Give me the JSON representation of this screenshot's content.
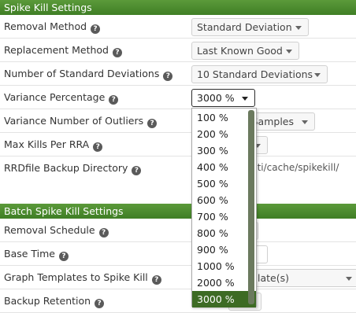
{
  "sections": {
    "spike_kill": {
      "title": "Spike Kill Settings"
    },
    "batch_spike_kill": {
      "title": "Batch Spike Kill Settings"
    }
  },
  "help_icon_glyph": "?",
  "fields": {
    "removal_method": {
      "label": "Removal Method",
      "value": "Standard Deviation"
    },
    "replacement_method": {
      "label": "Replacement Method",
      "value": "Last Known Good"
    },
    "num_std_devs": {
      "label": "Number of Standard Deviations",
      "value": "10 Standard Deviations"
    },
    "variance_percentage": {
      "label": "Variance Percentage",
      "value": "3000 %"
    },
    "variance_outliers": {
      "label": "Variance Number of Outliers",
      "value_fragment": "Samples"
    },
    "max_kills": {
      "label": "Max Kills Per RRA"
    },
    "backup_dir": {
      "label": "RRDfile Backup Directory",
      "value_fragment": "/cacti/cache/spikekill/"
    },
    "removal_schedule": {
      "label": "Removal Schedule"
    },
    "base_time": {
      "label": "Base Time"
    },
    "graph_templates": {
      "label": "Graph Templates to Spike Kill",
      "value_fragment": "late(s)"
    },
    "backup_retention": {
      "label": "Backup Retention"
    }
  },
  "dropdown": {
    "options": [
      "100 %",
      "200 %",
      "300 %",
      "400 %",
      "500 %",
      "600 %",
      "700 %",
      "800 %",
      "900 %",
      "1000 %",
      "2000 %",
      "3000 %"
    ],
    "selected": "3000 %"
  },
  "colors": {
    "section_header_bg": "#4a8a2e",
    "selected_option_bg": "#3d6b24",
    "scrollbar": "#6b7a5e"
  },
  "icons": {
    "help": "help-icon",
    "dropdown": "chevron-down-icon"
  }
}
